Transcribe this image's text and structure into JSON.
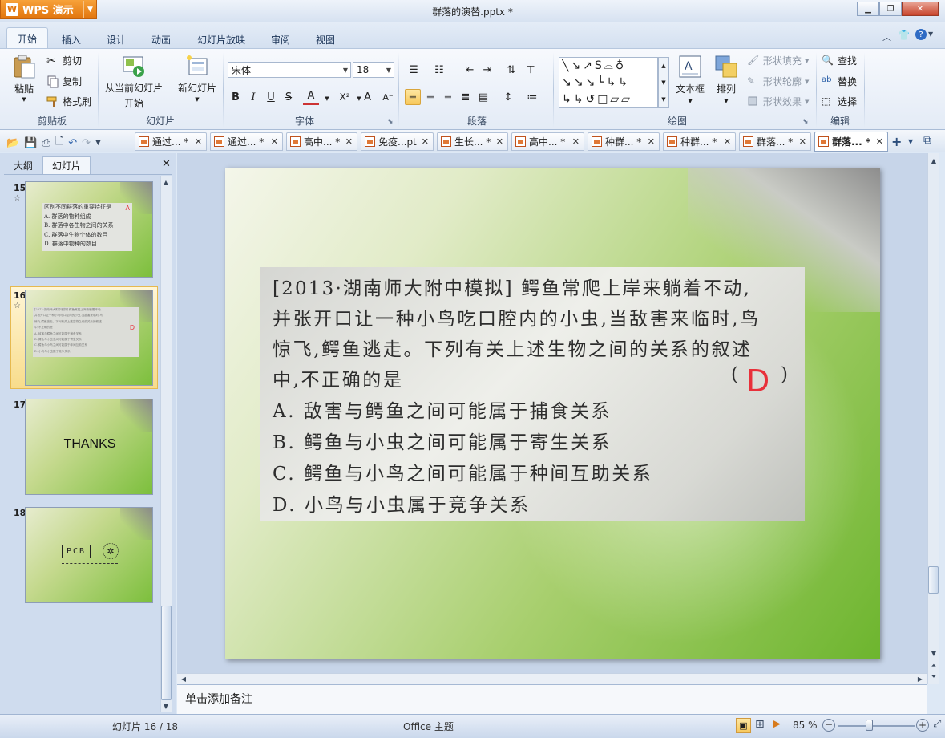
{
  "app": {
    "name": "WPS 演示",
    "logo_text": "W",
    "document_title": "群落的演替.pptx *"
  },
  "ribbon_tabs": [
    "开始",
    "插入",
    "设计",
    "动画",
    "幻灯片放映",
    "审阅",
    "视图"
  ],
  "clipboard": {
    "paste": "粘贴",
    "cut": "剪切",
    "copy": "复制",
    "format_painter": "格式刷",
    "group": "剪贴板"
  },
  "slides_group": {
    "from_current": "从当前幻灯片",
    "from_current_2": "开始",
    "new_slide": "新幻灯片",
    "group": "幻灯片"
  },
  "font_group": {
    "font_name": "宋体",
    "font_size": "18",
    "group": "字体"
  },
  "paragraph_group": {
    "group": "段落"
  },
  "drawing_group": {
    "textbox": "文本框",
    "arrange": "排列",
    "shape_fill": "形状填充",
    "shape_outline": "形状轮廓",
    "shape_effect": "形状效果",
    "group": "绘图"
  },
  "edit_group": {
    "find": "查找",
    "replace": "替换",
    "select": "选择",
    "group": "编辑"
  },
  "doc_tabs": [
    {
      "label": "通过... *",
      "active": false
    },
    {
      "label": "通过... *",
      "active": false
    },
    {
      "label": "高中... *",
      "active": false
    },
    {
      "label": "免疫...pt",
      "active": false
    },
    {
      "label": "生长... *",
      "active": false
    },
    {
      "label": "高中... *",
      "active": false
    },
    {
      "label": "种群... *",
      "active": false
    },
    {
      "label": "种群... *",
      "active": false
    },
    {
      "label": "群落... *",
      "active": false
    },
    {
      "label": "群落... *",
      "active": true
    }
  ],
  "left_panel": {
    "tabs": [
      "大纲",
      "幻灯片"
    ],
    "active_tab": "幻灯片",
    "thumbnails": [
      {
        "num": "15",
        "lines": [
          "区别不同群落的重要特征是",
          "A. 群落的物种组成",
          "B. 群落中各生物之间的关系",
          "C. 群落中生物个体的数目",
          "D. 群落中物种的数目"
        ],
        "mark": "A"
      },
      {
        "num": "16",
        "selected": true,
        "lines": [
          "[2013·湖南师大附中模拟] 鳄鱼常爬上岸来躺着不动,",
          "并张开口让一种小鸟吃口腔内的小虫,当敌害来临时,鸟",
          "惊飞,鳄鱼逃走。下列有关上述生物之间的关系的叙述",
          "中,不正确的是",
          "A. 敌害与鳄鱼之间可能属于捕食关系",
          "B. 鳄鱼与小虫之间可能属于寄生关系",
          "C. 鳄鱼与小鸟之间可能属于种间互助关系",
          "D. 小鸟与小虫属于竞争关系"
        ],
        "mark": "D"
      },
      {
        "num": "17",
        "text": "THANKS"
      },
      {
        "num": "18",
        "text": "PCB"
      }
    ]
  },
  "slide": {
    "question_lines": [
      "[2013·湖南师大附中模拟] 鳄鱼常爬上岸来躺着不动,",
      "并张开口让一种小鸟吃口腔内的小虫,当敌害来临时,鸟",
      "惊飞,鳄鱼逃走。下列有关上述生物之间的关系的叙述",
      "中,不正确的是"
    ],
    "paren_open": "(",
    "paren_close": ")",
    "answer": "D",
    "options": [
      "A.  敌害与鳄鱼之间可能属于捕食关系",
      "B.  鳄鱼与小虫之间可能属于寄生关系",
      "C.  鳄鱼与小鸟之间可能属于种间互助关系",
      "D.  小鸟与小虫属于竞争关系"
    ]
  },
  "notes_placeholder": "单击添加备注",
  "status": {
    "slide_counter": "幻灯片 16 / 18",
    "theme": "Office 主题",
    "zoom": "85 %"
  },
  "colors": {
    "answer_red": "#e8303a",
    "wps_orange": "#e2750d",
    "slide_green": "#6db52e"
  }
}
